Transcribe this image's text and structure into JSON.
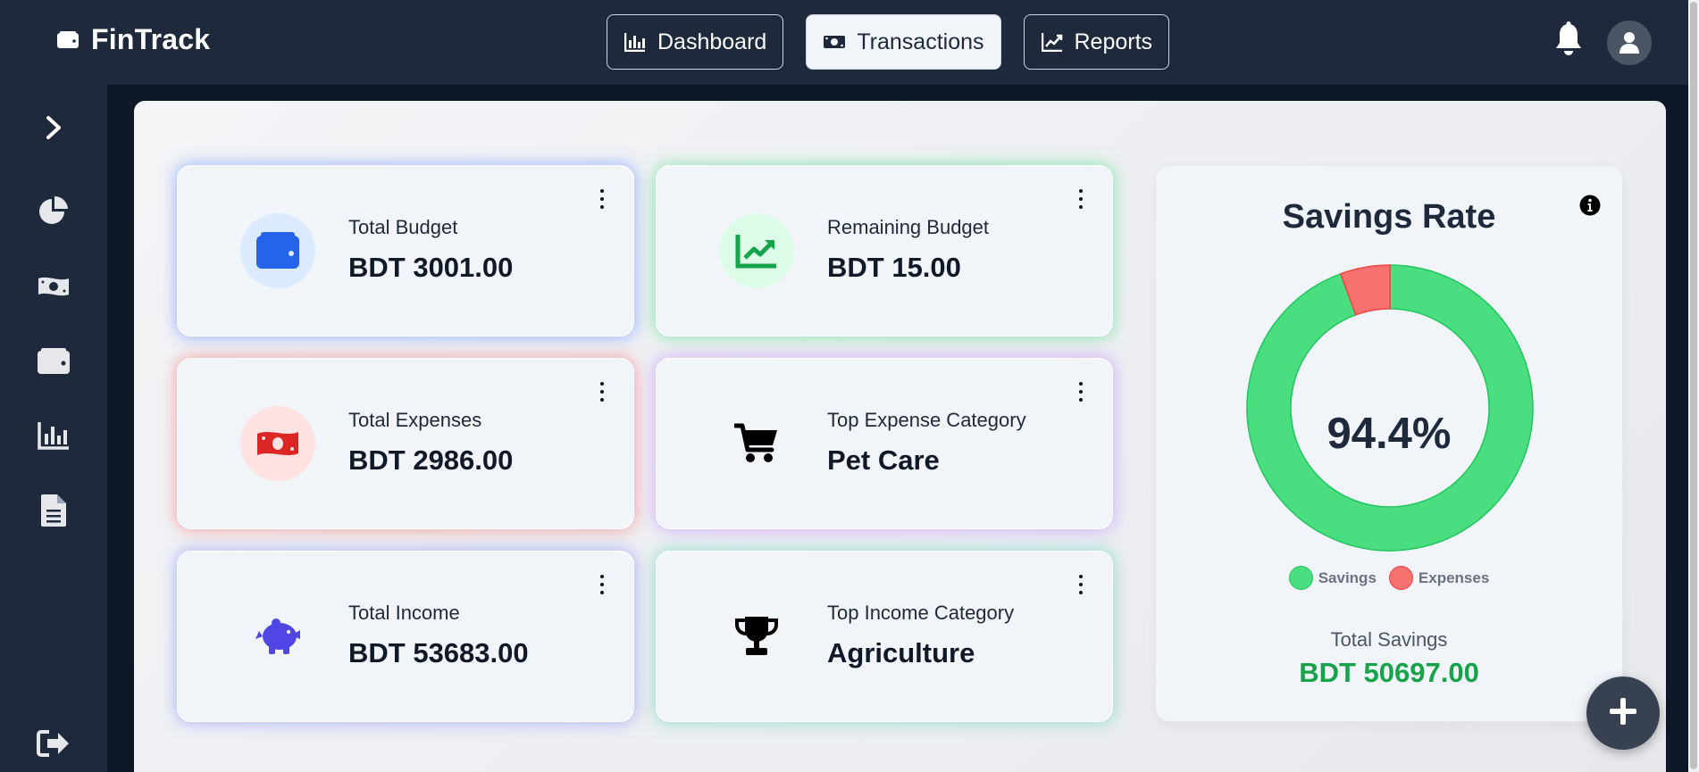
{
  "app": {
    "name": "FinTrack",
    "logo_icon": "wallet-icon"
  },
  "nav": {
    "items": [
      {
        "label": "Dashboard",
        "icon": "bar-chart-icon",
        "active": false
      },
      {
        "label": "Transactions",
        "icon": "money-bill-icon",
        "active": true
      },
      {
        "label": "Reports",
        "icon": "line-chart-icon",
        "active": false
      }
    ]
  },
  "header": {
    "notifications_icon": "bell-icon",
    "profile_icon": "user-icon"
  },
  "sidebar": {
    "items": [
      {
        "icon": "chevron-right-icon"
      },
      {
        "icon": "pie-chart-icon"
      },
      {
        "icon": "money-bill-icon"
      },
      {
        "icon": "wallet-icon"
      },
      {
        "icon": "bar-chart-icon"
      },
      {
        "icon": "file-icon"
      },
      {
        "icon": "sign-out-icon"
      }
    ]
  },
  "cards": [
    {
      "label": "Total Budget",
      "value": "BDT 3001.00",
      "icon": "wallet-icon",
      "accent": "#2563eb",
      "icon_bg": "#dbeafe"
    },
    {
      "label": "Remaining Budget",
      "value": "BDT 15.00",
      "icon": "trend-up-icon",
      "accent": "#16a34a",
      "icon_bg": "#dcfce7"
    },
    {
      "label": "Total Expenses",
      "value": "BDT 2986.00",
      "icon": "money-bill-icon",
      "accent": "#dc2626",
      "icon_bg": "#fee2e2"
    },
    {
      "label": "Top Expense Category",
      "value": "Pet Care",
      "icon": "cart-icon",
      "accent": "#000000",
      "icon_bg": "transparent"
    },
    {
      "label": "Total Income",
      "value": "BDT 53683.00",
      "icon": "piggy-bank-icon",
      "accent": "#4f46e5",
      "icon_bg": "transparent"
    },
    {
      "label": "Top Income Category",
      "value": "Agriculture",
      "icon": "trophy-icon",
      "accent": "#000000",
      "icon_bg": "transparent"
    }
  ],
  "savings": {
    "title": "Savings Rate",
    "percent_label": "94.4%",
    "total_label": "Total Savings",
    "total_value": "BDT 50697.00",
    "info_icon": "info-icon"
  },
  "chart_data": {
    "type": "pie",
    "categories": [
      "Savings",
      "Expenses"
    ],
    "values": [
      94.4,
      5.6
    ],
    "colors": [
      "#4ade80",
      "#f87171"
    ],
    "title": "Savings Rate",
    "legend": "bottom"
  },
  "fab": {
    "icon": "plus-icon"
  }
}
